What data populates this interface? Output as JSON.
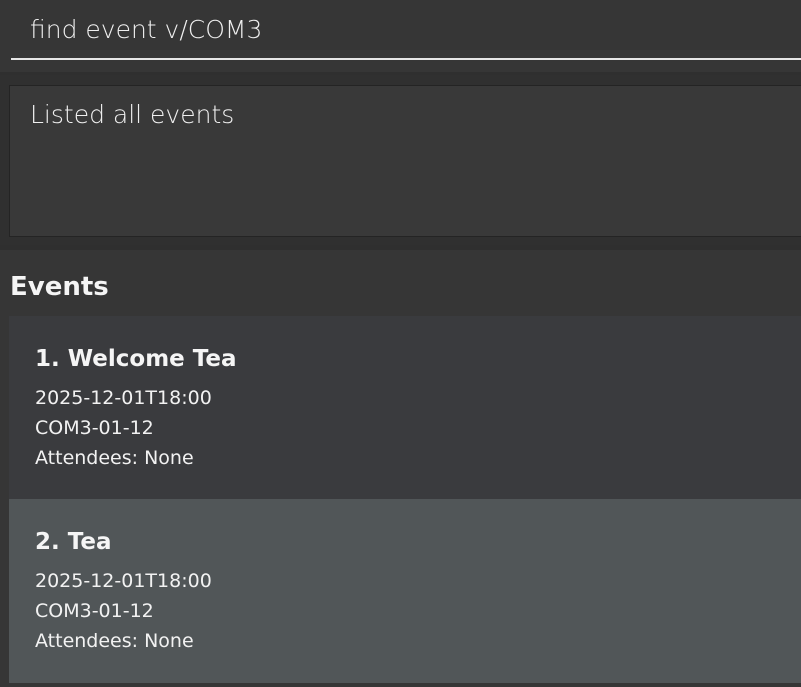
{
  "command_box": {
    "value": "find event v/COM3"
  },
  "result_display": {
    "text": "Listed all events"
  },
  "events_panel": {
    "heading": "Events",
    "events": [
      {
        "title": "1. Welcome Tea",
        "datetime": "2025-12-01T18:00",
        "venue": "COM3-01-12",
        "attendees": "Attendees: None"
      },
      {
        "title": "2. Tea",
        "datetime": "2025-12-01T18:00",
        "venue": "COM3-01-12",
        "attendees": "Attendees: None"
      }
    ]
  }
}
